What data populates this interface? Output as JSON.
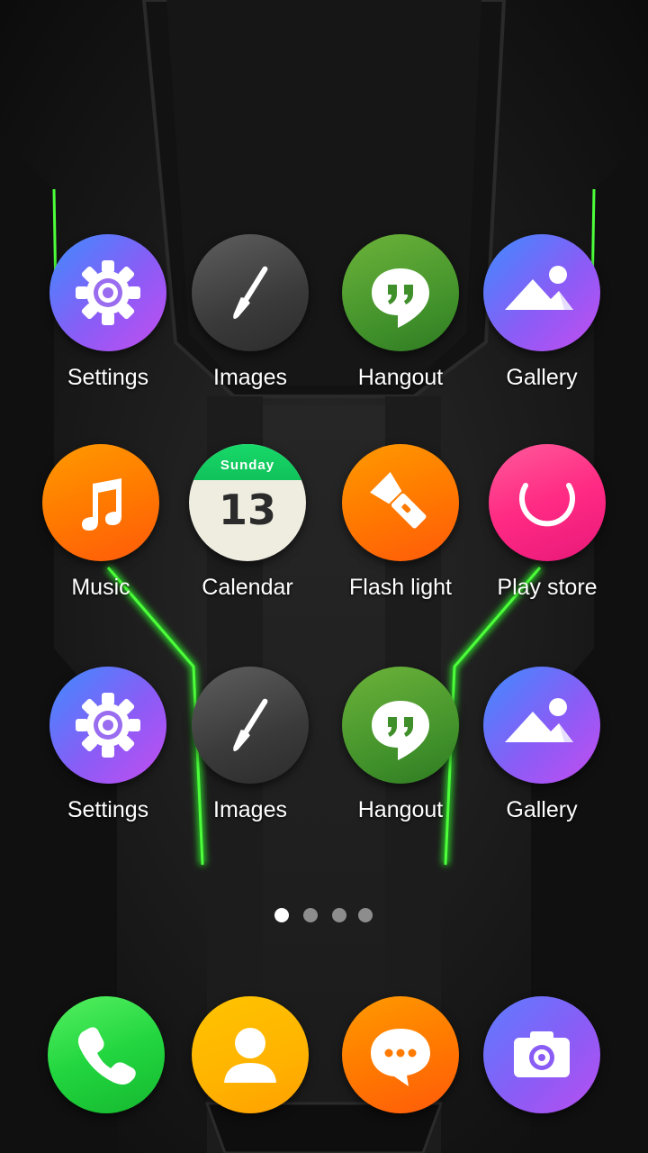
{
  "grid": [
    {
      "label": "Settings",
      "icon": "settings-gear-icon"
    },
    {
      "label": "Images",
      "icon": "paintbrush-icon"
    },
    {
      "label": "Hangout",
      "icon": "hangouts-quote-icon"
    },
    {
      "label": "Gallery",
      "icon": "mountain-sun-icon"
    },
    {
      "label": "Music",
      "icon": "music-note-icon"
    },
    {
      "label": "Calendar",
      "icon": "calendar-icon",
      "day": "Sunday",
      "date": "13"
    },
    {
      "label": "Flash light",
      "icon": "flashlight-icon"
    },
    {
      "label": "Play store",
      "icon": "play-store-bag-icon"
    },
    {
      "label": "Settings",
      "icon": "settings-gear-icon"
    },
    {
      "label": "Images",
      "icon": "paintbrush-icon"
    },
    {
      "label": "Hangout",
      "icon": "hangouts-quote-icon"
    },
    {
      "label": "Gallery",
      "icon": "mountain-sun-icon"
    }
  ],
  "dock": [
    {
      "icon": "phone-handset-icon"
    },
    {
      "icon": "contact-person-icon"
    },
    {
      "icon": "message-bubble-icon"
    },
    {
      "icon": "camera-icon"
    }
  ],
  "page_indicator": {
    "pages": 4,
    "current": 1
  },
  "colors": {
    "wallpaper_accent": "#2dff2a",
    "background": "#141414"
  }
}
